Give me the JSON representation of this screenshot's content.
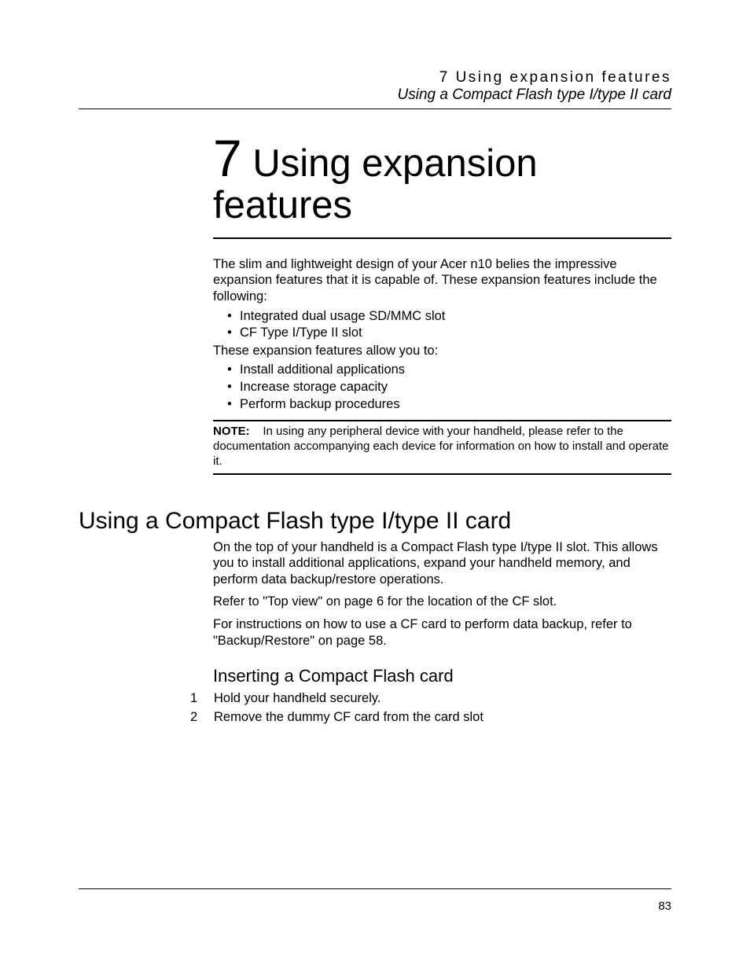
{
  "header": {
    "line1": "7 Using expansion features",
    "line2": "Using a Compact Flash type I/type II card"
  },
  "chapter": {
    "number": "7",
    "title_rest": " Using expansion",
    "title_line2": "features"
  },
  "intro": {
    "p1": "The slim and lightweight design of your Acer n10 belies the impressive expansion features that it is capable of. These expansion features include the following:",
    "bullets1": [
      "Integrated dual usage SD/MMC slot",
      "CF Type I/Type II slot"
    ],
    "p2": "These expansion features allow you to:",
    "bullets2": [
      "Install additional applications",
      "Increase storage capacity",
      "Perform backup procedures"
    ]
  },
  "note": {
    "label": "NOTE:",
    "text": "In using any peripheral device with your handheld, please refer to the documentation accompanying each device for information on how to install and operate it."
  },
  "section": {
    "heading": "Using a Compact Flash type I/type II card",
    "p1": "On the top of your handheld is a Compact Flash type I/type II slot. This allows you to install additional applications, expand your handheld memory, and perform data backup/restore operations.",
    "p2": "Refer to \"Top view\" on page 6 for the location of the CF slot.",
    "p3": "For instructions on how to use a CF card to perform data backup, refer to \"Backup/Restore\" on page 58."
  },
  "subsection": {
    "heading": "Inserting a Compact Flash card",
    "steps": [
      "Hold your handheld securely.",
      "Remove the dummy CF card from the card slot"
    ]
  },
  "page_number": "83"
}
